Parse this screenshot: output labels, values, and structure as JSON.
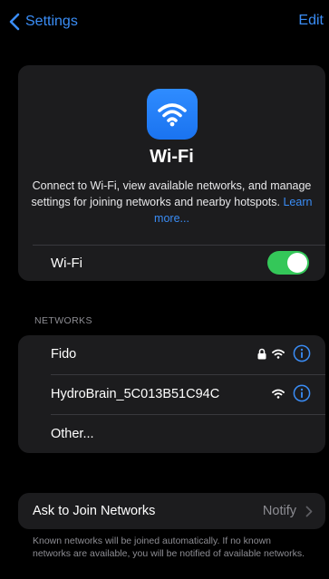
{
  "nav": {
    "back_label": "Settings",
    "edit_label": "Edit"
  },
  "header": {
    "icon": "wifi-icon",
    "title": "Wi-Fi",
    "description": "Connect to Wi-Fi, view available networks, and manage settings for joining networks and nearby hotspots.",
    "learn_more": "Learn more..."
  },
  "wifi_toggle": {
    "label": "Wi-Fi",
    "on": true
  },
  "networks": {
    "header": "NETWORKS",
    "items": [
      {
        "name": "Fido",
        "secured": true
      },
      {
        "name": "HydroBrain_5C013B51C94C",
        "secured": false
      }
    ],
    "other_label": "Other..."
  },
  "ask_to_join": {
    "label": "Ask to Join Networks",
    "value": "Notify"
  },
  "footer_note": "Known networks will be joined automatically. If no known networks are available, you will be notified of available networks.",
  "colors": {
    "accent": "#3a8df6",
    "toggle_on": "#34c759",
    "card_bg": "#1c1c1e",
    "secondary_text": "#8d8d93"
  }
}
